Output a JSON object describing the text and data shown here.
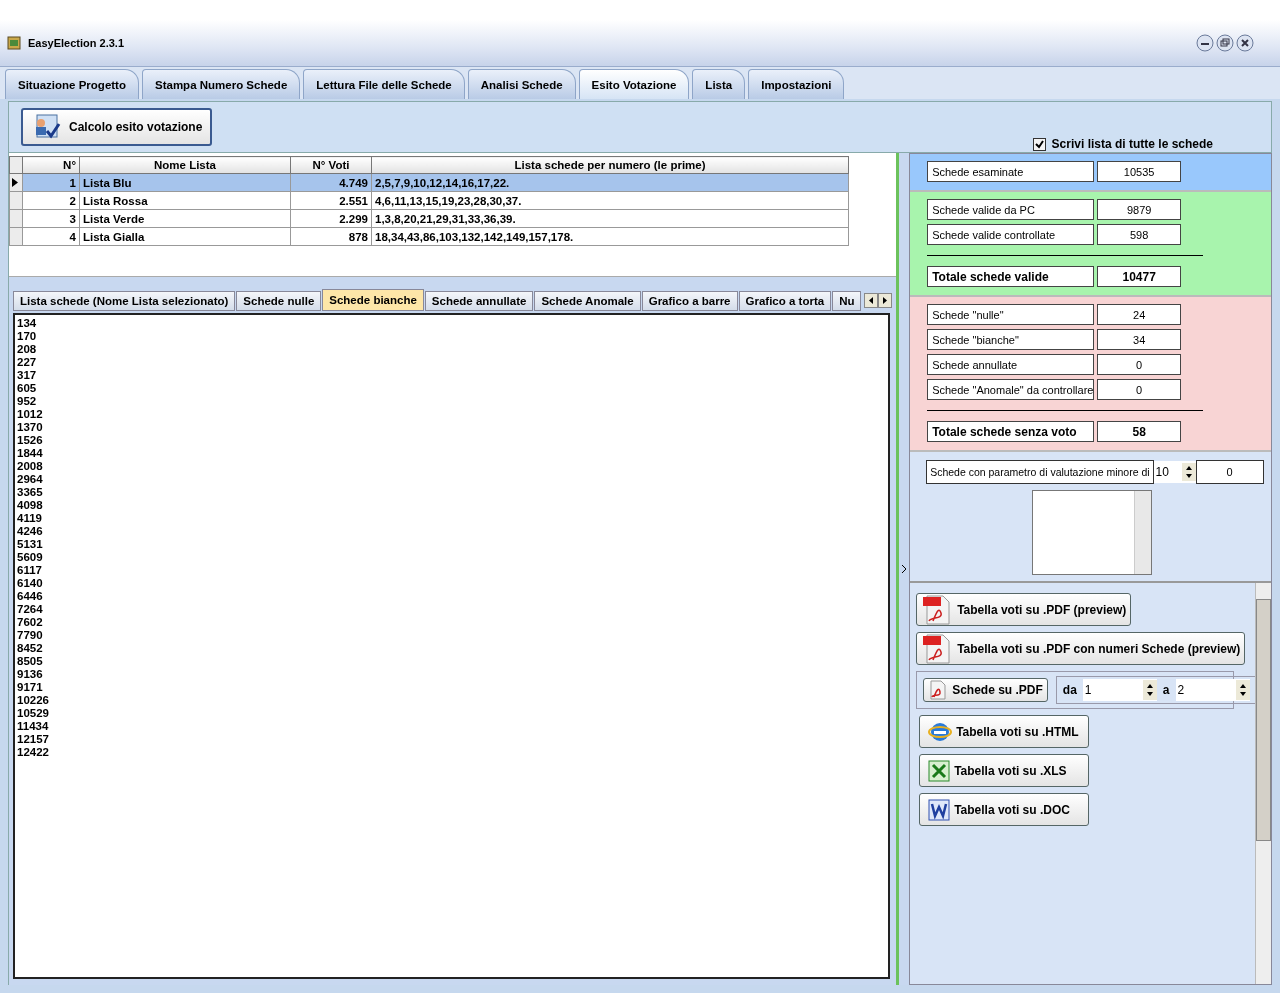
{
  "window": {
    "title": "EasyElection 2.3.1"
  },
  "tabs": [
    {
      "label": "Situazione Progetto",
      "selected": false
    },
    {
      "label": "Stampa Numero Schede",
      "selected": false
    },
    {
      "label": "Lettura File delle Schede",
      "selected": false
    },
    {
      "label": "Analisi Schede",
      "selected": false
    },
    {
      "label": "Esito Votazione",
      "selected": true
    },
    {
      "label": "Lista",
      "selected": false
    },
    {
      "label": "Impostazioni",
      "selected": false
    }
  ],
  "toolbar": {
    "button": "Calcolo esito votazione",
    "checkbox": {
      "label": "Scrivi lista di tutte le schede",
      "checked": true
    }
  },
  "table": {
    "columns": [
      "N°",
      "Nome Lista",
      "N° Voti",
      "Lista schede per numero (le prime)"
    ],
    "rows": [
      {
        "cells": [
          "1",
          "Lista Blu",
          "4.749",
          "2,5,7,9,10,12,14,16,17,22."
        ],
        "selected": true
      },
      {
        "cells": [
          "2",
          "Lista Rossa",
          "2.551",
          "4,6,11,13,15,19,23,28,30,37."
        ],
        "selected": false
      },
      {
        "cells": [
          "3",
          "Lista Verde",
          "2.299",
          "1,3,8,20,21,29,31,33,36,39."
        ],
        "selected": false
      },
      {
        "cells": [
          "4",
          "Lista Gialla",
          "878",
          "18,34,43,86,103,132,142,149,157,178."
        ],
        "selected": false
      }
    ]
  },
  "subtabs": [
    {
      "label": "Lista schede (Nome Lista selezionato)",
      "selected": false
    },
    {
      "label": "Schede nulle",
      "selected": false
    },
    {
      "label": "Schede bianche",
      "selected": true
    },
    {
      "label": "Schede annullate",
      "selected": false
    },
    {
      "label": "Schede Anomale",
      "selected": false
    },
    {
      "label": "Grafico a barre",
      "selected": false
    },
    {
      "label": "Grafico a torta",
      "selected": false
    },
    {
      "label": "Nu",
      "selected": false
    }
  ],
  "numbers": [
    "134",
    "170",
    "208",
    "227",
    "317",
    "605",
    "952",
    "1012",
    "1370",
    "1526",
    "1844",
    "2008",
    "2964",
    "3365",
    "4098",
    "4119",
    "4246",
    "5131",
    "5609",
    "6117",
    "6140",
    "6446",
    "7264",
    "7602",
    "7790",
    "8452",
    "8505",
    "9136",
    "9171",
    "10226",
    "10529",
    "11434",
    "12157",
    "12422"
  ],
  "stat_groups": [
    {
      "color": "#99c8fc",
      "items": [
        {
          "kind": "stat",
          "label": "Schede esaminate",
          "value": "10535"
        }
      ]
    },
    {
      "color": "#a8f4ad",
      "items": [
        {
          "kind": "stat",
          "label": "Schede valide da PC",
          "value": "9879"
        },
        {
          "kind": "stat",
          "label": "Schede valide controllate",
          "value": "598"
        },
        {
          "kind": "total",
          "label": "Totale schede valide",
          "value": "10477"
        }
      ]
    },
    {
      "color": "#f8d4d4",
      "items": [
        {
          "kind": "stat",
          "label": "Schede \"nulle\"",
          "value": "24"
        },
        {
          "kind": "stat",
          "label": "Schede \"bianche\"",
          "value": "34"
        },
        {
          "kind": "stat",
          "label": "Schede annullate",
          "value": "0"
        },
        {
          "kind": "stat",
          "label": "Schede \"Anomale\" da controllare",
          "value": "0"
        },
        {
          "kind": "total",
          "label": "Totale schede senza voto",
          "value": "58"
        }
      ]
    }
  ],
  "threshold": {
    "label": "Schede con parametro di valutazione minore di",
    "spin": "10",
    "value": "0"
  },
  "exports": [
    {
      "kind": "pdf",
      "label": "Tabella voti su .PDF (preview)"
    },
    {
      "kind": "pdf",
      "label": "Tabella voti su .PDF con numeri Schede (preview)"
    }
  ],
  "pdf_range": {
    "button": "Schede su .PDF",
    "from_label": "da",
    "from": "1",
    "to_label": "a",
    "to": "2"
  },
  "exports2": [
    {
      "kind": "html",
      "label": "Tabella voti su .HTML"
    },
    {
      "kind": "xls",
      "label": "Tabella voti su .XLS"
    },
    {
      "kind": "doc",
      "label": "Tabella voti su .DOC"
    }
  ]
}
